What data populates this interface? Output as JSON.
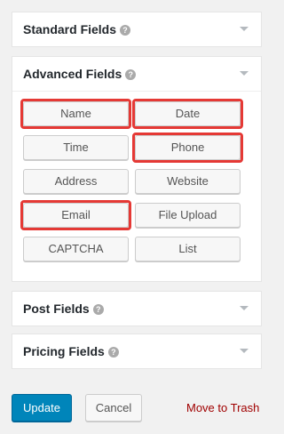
{
  "panels": {
    "standard": {
      "title": "Standard Fields",
      "help": "?"
    },
    "advanced": {
      "title": "Advanced Fields",
      "help": "?",
      "buttons": [
        "Name",
        "Date",
        "Time",
        "Phone",
        "Address",
        "Website",
        "Email",
        "File Upload",
        "CAPTCHA",
        "List"
      ]
    },
    "post": {
      "title": "Post Fields",
      "help": "?"
    },
    "pricing": {
      "title": "Pricing Fields",
      "help": "?"
    }
  },
  "actions": {
    "update_label": "Update",
    "cancel_label": "Cancel",
    "trash_label": "Move to Trash"
  },
  "highlighted_buttons": [
    "Name",
    "Date",
    "Phone",
    "Email"
  ],
  "colors": {
    "primary": "#0085ba",
    "trash": "#a00000",
    "highlight": "#e53935"
  }
}
